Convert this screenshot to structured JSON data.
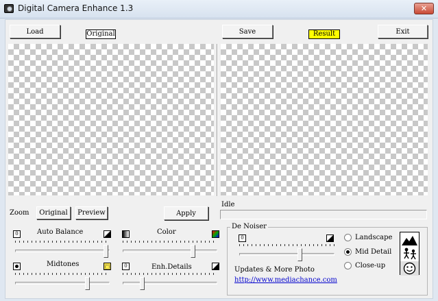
{
  "window": {
    "title": "Digital Camera Enhance 1.3",
    "close_glyph": "✕"
  },
  "toolbar": {
    "load": "Load",
    "original_tag": "Original",
    "save": "Save",
    "result_tag": "Result",
    "exit": "Exit",
    "result_color": "#ffff00"
  },
  "zoom": {
    "label": "Zoom",
    "original": "Original",
    "preview": "Preview"
  },
  "apply": "Apply",
  "status": "Idle",
  "sliders": {
    "auto_balance": {
      "label": "Auto Balance",
      "value": 0.96
    },
    "color": {
      "label": "Color",
      "value": 0.74
    },
    "midtones": {
      "label": "Midtones",
      "value": 0.76
    },
    "enh_details": {
      "label": "Enh.Details",
      "value": 0.2
    },
    "de_noiser": {
      "value": 0.63
    }
  },
  "denoiser": {
    "title": "De Noiser",
    "options": [
      {
        "label": "Landscape",
        "checked": false
      },
      {
        "label": "Mid Detail",
        "checked": true
      },
      {
        "label": "Close-up",
        "checked": false
      }
    ],
    "updates_text": "Updates & More Photo",
    "url": "http://www.mediachance.com"
  },
  "icons": {
    "app": "camera-icon",
    "close": "close-icon",
    "landscape": "mountain-icon",
    "mid_detail": "people-icon",
    "close_up": "face-icon"
  }
}
